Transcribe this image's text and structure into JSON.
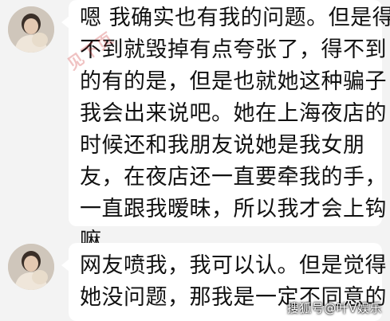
{
  "messages": [
    {
      "lines": [
        "嗯 我确实也有我的问题。但是得",
        "不到就毁掉有点夸张了，得不到",
        "的有的是，但是也就她这种骗子",
        "我会出来说吧。她在上海夜店的",
        "时候还和我朋友说她是我女朋",
        "友，在夜店还一直要牵我的手，",
        "一直跟我暧昧，所以我才会上钩",
        "嘛"
      ]
    },
    {
      "lines": [
        "网友喷我，我可以认。但是觉得",
        "她没问题，那我是一定不同意的"
      ]
    }
  ],
  "stamp_text": "见下页",
  "watermark": "搜狐号@叶V娱乐"
}
